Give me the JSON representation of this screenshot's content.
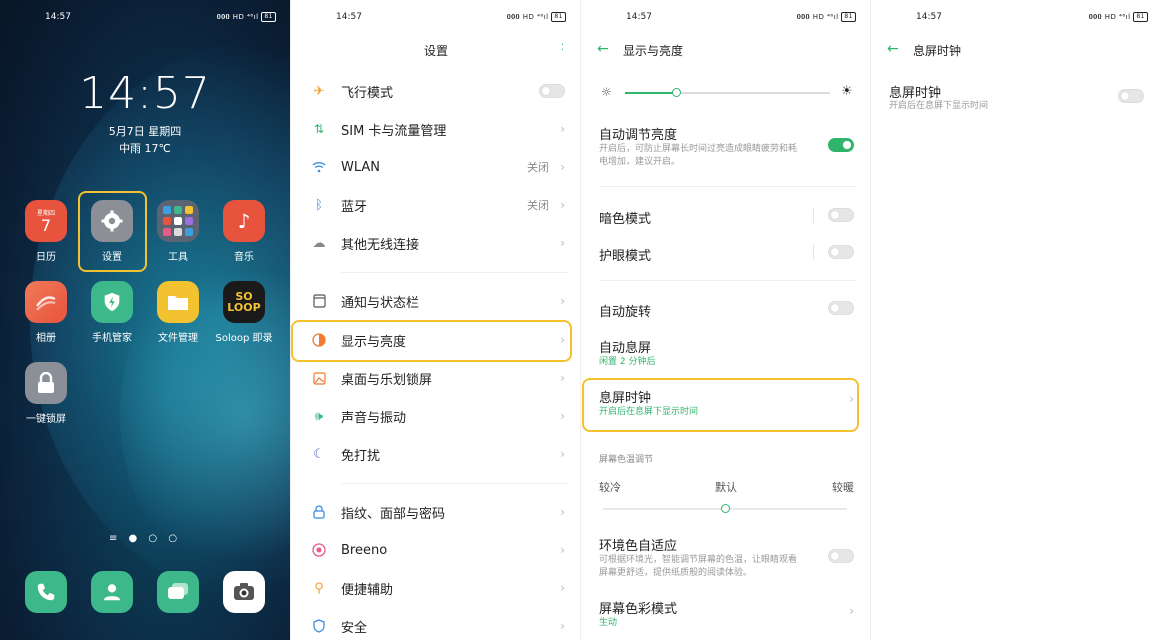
{
  "status": {
    "time": "14:57",
    "icons": "𝟎𝟎𝟎 HD ⁴⁶ıl",
    "battery": "81"
  },
  "home": {
    "clock": "14:57",
    "date": "5月7日 星期四",
    "weather": "中雨 17℃",
    "calendar_badge_day": "星期四",
    "calendar_badge_num": "7",
    "apps": [
      {
        "label": "日历",
        "icon": "calendar-icon",
        "color": "#e8533e"
      },
      {
        "label": "设置",
        "icon": "gear-icon",
        "color": "#8c8f96"
      },
      {
        "label": "工具",
        "icon": "tools-folder-icon",
        "color": "#5b6473"
      },
      {
        "label": "音乐",
        "icon": "music-note-icon",
        "color": "#e8533e"
      },
      {
        "label": "相册",
        "icon": "photos-icon",
        "color": "#e8533e"
      },
      {
        "label": "手机管家",
        "icon": "shield-bolt-icon",
        "color": "#3cb88a"
      },
      {
        "label": "文件管理",
        "icon": "folder-icon",
        "color": "#f2c230"
      },
      {
        "label": "Soloop 即录",
        "icon": "soloop-logo-icon",
        "color": "#1a1a1a"
      },
      {
        "label": "一键锁屏",
        "icon": "lock-icon",
        "color": "#8a8f98"
      }
    ],
    "dock": [
      {
        "icon": "phone-icon",
        "color": "#3cb88a"
      },
      {
        "icon": "contacts-icon",
        "color": "#3cb88a"
      },
      {
        "icon": "messages-icon",
        "color": "#3cb88a"
      },
      {
        "icon": "camera-icon",
        "color": "#ffffff"
      }
    ],
    "soloop_logo_text": "SO\nLOOP"
  },
  "settings": {
    "title": "设置",
    "items": [
      {
        "label": "飞行模式",
        "value": "",
        "control": "toggle-off"
      },
      {
        "label": "SIM 卡与流量管理",
        "value": "",
        "control": "chevron"
      },
      {
        "label": "WLAN",
        "value": "关闭",
        "control": "chevron"
      },
      {
        "label": "蓝牙",
        "value": "关闭",
        "control": "chevron"
      },
      {
        "label": "其他无线连接",
        "value": "",
        "control": "chevron"
      },
      {
        "label": "通知与状态栏",
        "value": "",
        "control": "chevron"
      },
      {
        "label": "显示与亮度",
        "value": "",
        "control": "chevron"
      },
      {
        "label": "桌面与乐划锁屏",
        "value": "",
        "control": "chevron"
      },
      {
        "label": "声音与振动",
        "value": "",
        "control": "chevron"
      },
      {
        "label": "免打扰",
        "value": "",
        "control": "chevron"
      },
      {
        "label": "指纹、面部与密码",
        "value": "",
        "control": "chevron"
      },
      {
        "label": "Breeno",
        "value": "",
        "control": "chevron"
      },
      {
        "label": "便捷辅助",
        "value": "",
        "control": "chevron"
      },
      {
        "label": "安全",
        "value": "",
        "control": "chevron"
      }
    ]
  },
  "display": {
    "title": "显示与亮度",
    "brightness_level": 0.25,
    "auto_brightness": {
      "title": "自动调节亮度",
      "sub1": "开启后，可防止屏幕长时间过亮造成眼睛疲劳和耗",
      "sub2": "电增加，建议开启。"
    },
    "dark_mode": "暗色模式",
    "eye_care": "护眼模式",
    "auto_rotate": "自动旋转",
    "auto_sleep": {
      "title": "自动息屏",
      "sub": "闲置 2 分钟后"
    },
    "aod": {
      "title": "息屏时钟",
      "sub": "开启后在息屏下显示时间"
    },
    "color_temp_section": "屏幕色温调节",
    "color_temp_labels": [
      "较冷",
      "默认",
      "较暖"
    ],
    "color_temp_level": 0.5,
    "ambient": {
      "title": "环境色自适应",
      "sub1": "可根据环境光，智能调节屏幕的色温，让眼睛观看",
      "sub2": "屏幕更舒适，提供纸质般的阅读体验。"
    },
    "color_mode": {
      "title": "屏幕色彩模式",
      "sub": "生动"
    }
  },
  "aod_page": {
    "title": "息屏时钟",
    "item_title": "息屏时钟",
    "item_sub": "开启后在息屏下显示时间"
  },
  "colors": {
    "accent": "#2fb56b",
    "highlight": "#f2c230"
  }
}
